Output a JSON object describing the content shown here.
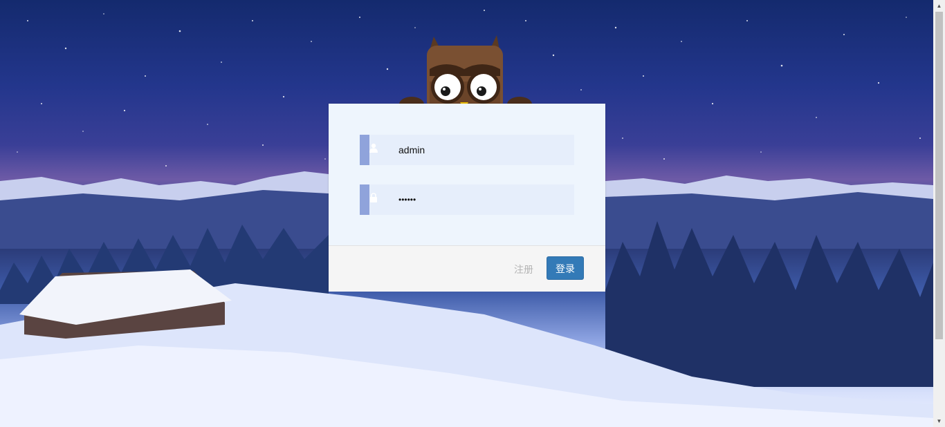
{
  "login_form": {
    "username": {
      "value": "admin",
      "icon": "user-icon"
    },
    "password": {
      "value": "••••••",
      "icon": "lock-icon"
    },
    "register_label": "注册",
    "login_label": "登录"
  },
  "colors": {
    "panel_bg": "#eef5fd",
    "field_bg": "#e6eefb",
    "field_accent": "#8fa3db",
    "login_button": "#337ab7",
    "register_text": "#b4b4b4"
  },
  "decoration": {
    "mascot": "owl-mascot",
    "background": "snowy-mountain-night-landscape"
  }
}
